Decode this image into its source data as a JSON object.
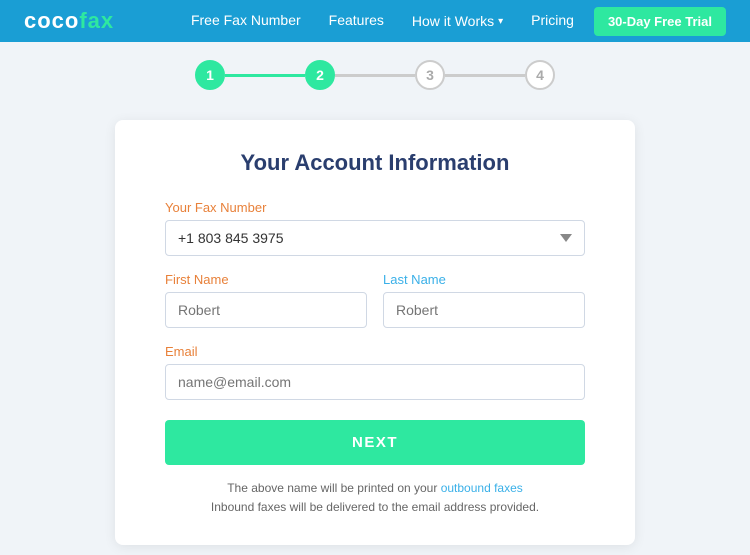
{
  "navbar": {
    "logo_coco": "coco",
    "logo_fax": "fax",
    "nav_free_fax": "Free Fax Number",
    "nav_features": "Features",
    "nav_how_it_works": "How it Works",
    "nav_pricing": "Pricing",
    "btn_trial": "30-Day Free Trial"
  },
  "stepper": {
    "step1": "1",
    "step2": "2",
    "step3": "3",
    "step4": "4"
  },
  "card": {
    "title": "Your Account Information",
    "fax_label": "Your Fax Number",
    "fax_value": "+1 803 845 3975",
    "first_name_label": "First Name",
    "first_name_placeholder": "Robert",
    "last_name_label": "Last Name",
    "last_name_placeholder": "Robert",
    "email_label": "Email",
    "email_placeholder": "name@email.com",
    "next_button": "NEXT",
    "footer_line1": "The above name will be printed on your ",
    "footer_link1": "outbound faxes",
    "footer_line2": "Inbound faxes will be delivered to the email address provided."
  }
}
